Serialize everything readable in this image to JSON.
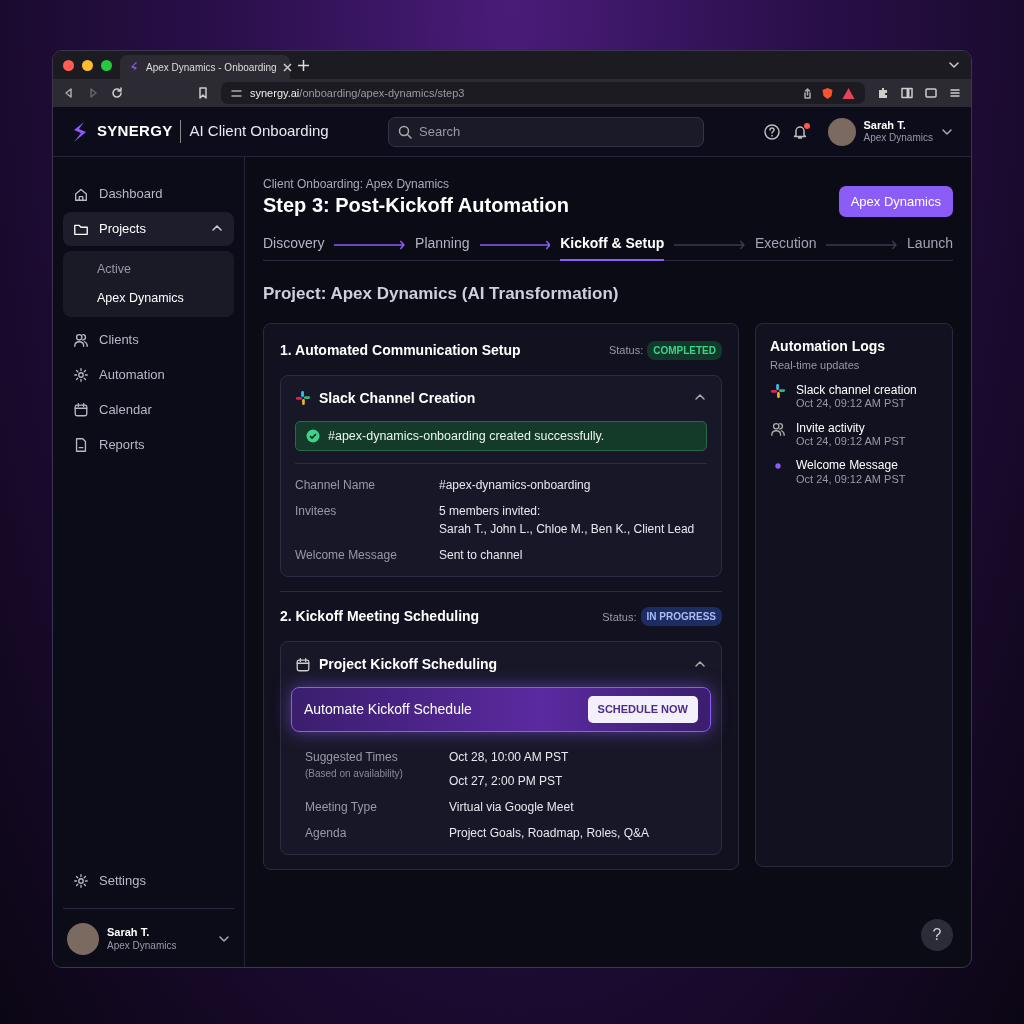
{
  "browser": {
    "tab_title": "Apex Dynamics - Onboarding",
    "address": {
      "host": "synergy.ai",
      "path": "/onboarding/apex-dynamics/step3"
    }
  },
  "header": {
    "brand": "SYNERGY",
    "product": "AI Client Onboarding",
    "search": {
      "placeholder": "Search"
    },
    "notifications": {
      "unread": true
    },
    "user": {
      "name": "Sarah T.",
      "company": "Apex Dynamics"
    }
  },
  "sidebar": {
    "items": [
      {
        "label": "Dashboard",
        "kind": "home",
        "selected": false
      },
      {
        "label": "Projects",
        "kind": "folder",
        "selected": true,
        "expanded": true,
        "children": [
          {
            "label": "Active",
            "selected": false
          },
          {
            "label": "Apex Dynamics",
            "selected": true
          }
        ]
      },
      {
        "label": "Clients",
        "kind": "people",
        "selected": false
      },
      {
        "label": "Automation",
        "kind": "gear",
        "selected": false
      },
      {
        "label": "Calendar",
        "kind": "calendar",
        "selected": false
      },
      {
        "label": "Reports",
        "kind": "report",
        "selected": false
      }
    ],
    "footer_items": [
      {
        "label": "Settings",
        "kind": "gear",
        "selected": false
      }
    ],
    "user": {
      "name": "Sarah T.",
      "company": "Apex Dynamics"
    }
  },
  "page": {
    "breadcrumb": "Client Onboarding: Apex Dynamics",
    "title": "Step 3: Post-Kickoff Automation",
    "client_button": "Apex Dynamics",
    "steps": [
      {
        "label": "Discovery",
        "completed": true,
        "selected": false
      },
      {
        "label": "Planning",
        "completed": true,
        "selected": false
      },
      {
        "label": "Kickoff & Setup",
        "completed": false,
        "selected": true
      },
      {
        "label": "Execution",
        "completed": false,
        "selected": false
      },
      {
        "label": "Launch",
        "completed": false,
        "selected": false
      }
    ],
    "project_title": "Project: Apex Dynamics (AI Transformation)"
  },
  "sections": [
    {
      "title": "1. Automated Communication Setup",
      "status_label": "Status:",
      "status": {
        "text": "COMPLETED",
        "kind": "success"
      },
      "card": {
        "kind": "slack",
        "title": "Slack Channel Creation",
        "expanded": true,
        "alert": {
          "kind": "success",
          "text": "#apex-dynamics-onboarding created successfully."
        },
        "details": [
          {
            "label": "Channel Name",
            "values": [
              "#apex-dynamics-onboarding"
            ]
          },
          {
            "label": "Invitees",
            "values": [
              "5 members invited:",
              "Sarah T., John L., Chloe M., Ben K., Client Lead"
            ]
          },
          {
            "label": "Welcome Message",
            "values": [
              "Sent to channel"
            ]
          }
        ]
      }
    },
    {
      "title": "2. Kickoff Meeting Scheduling",
      "status_label": "Status:",
      "status": {
        "text": "IN PROGRESS",
        "kind": "info"
      },
      "card": {
        "kind": "calendar",
        "title": "Project Kickoff Scheduling",
        "expanded": true,
        "action": {
          "text": "Automate Kickoff Schedule",
          "button": "SCHEDULE NOW"
        },
        "details": [
          {
            "label": "Suggested Times",
            "sublabel": "(Based on availability)",
            "values": [
              "Oct 28, 10:00 AM PST",
              "Oct 27, 2:00 PM PST"
            ]
          },
          {
            "label": "Meeting Type",
            "values": [
              "Virtual via Google Meet"
            ]
          },
          {
            "label": "Agenda",
            "values": [
              "Project Goals, Roadmap, Roles, Q&A"
            ]
          }
        ]
      }
    }
  ],
  "logs": {
    "title": "Automation Logs",
    "subtitle": "Real-time updates",
    "entries": [
      {
        "kind": "slack",
        "title": "Slack channel creation",
        "time": "Oct 24, 09:12 AM PST"
      },
      {
        "kind": "people",
        "title": "Invite activity",
        "time": "Oct 24, 09:12 AM PST"
      },
      {
        "kind": "dot",
        "title": "Welcome Message",
        "time": "Oct 24, 09:12 AM PST"
      }
    ]
  },
  "help_button": "?"
}
